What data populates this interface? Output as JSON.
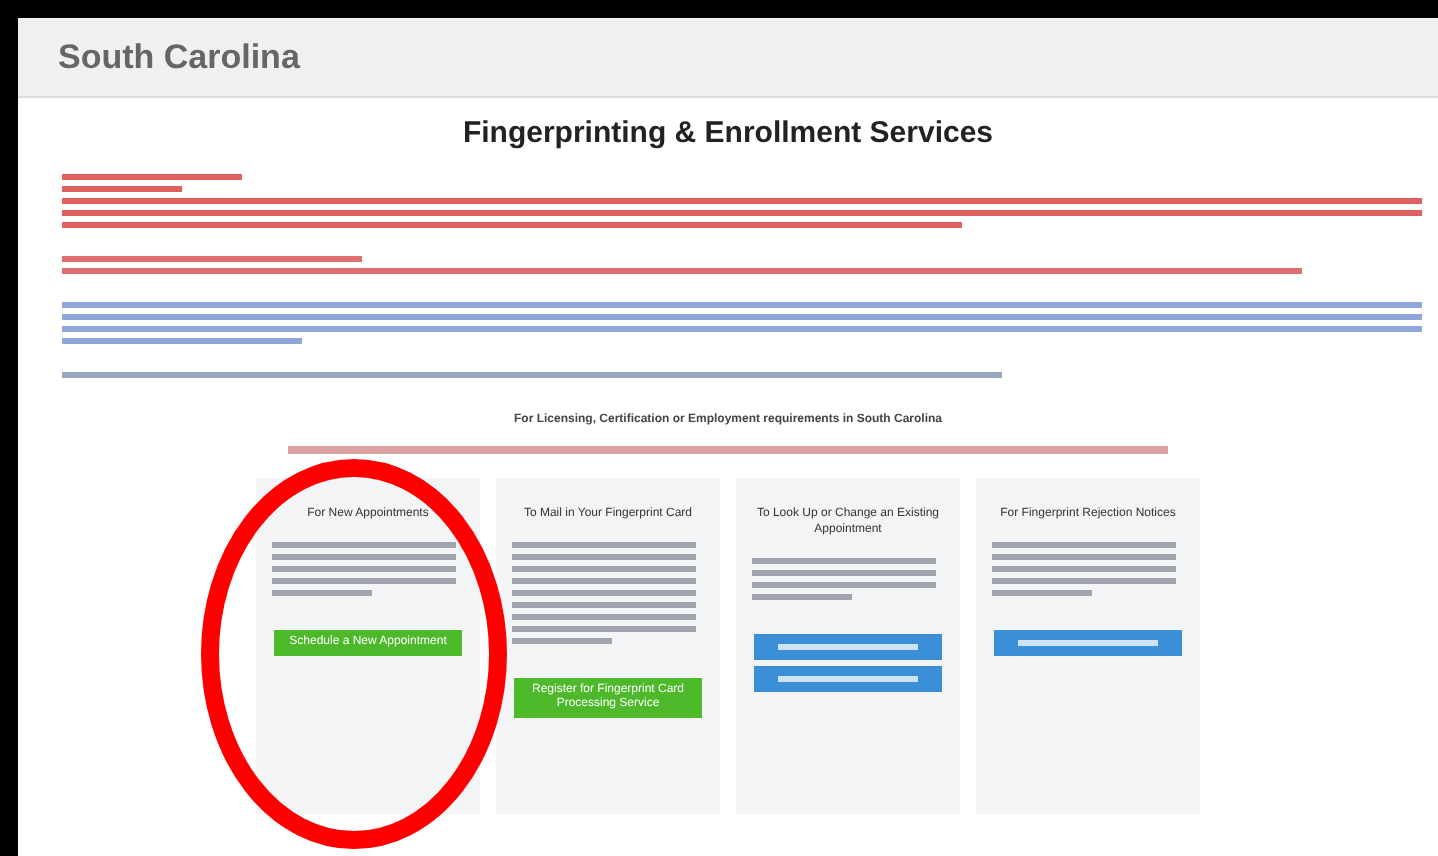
{
  "header": {
    "title": "South Carolina"
  },
  "page_title": "Fingerprinting & Enrollment Services",
  "section_heading": "For Licensing, Certification or Employment requirements in South Carolina",
  "cards": [
    {
      "title": "For New Appointments",
      "buttons": [
        {
          "label": "Schedule a New Appointment",
          "color": "#4cb82a"
        }
      ]
    },
    {
      "title": "To Mail in Your Fingerprint Card",
      "buttons": [
        {
          "label": "Register for Fingerprint Card Processing Service",
          "color": "#4cb82a"
        }
      ]
    },
    {
      "title": "To Look Up or Change an Existing Appointment",
      "buttons": [
        {
          "color": "#3a8fd6"
        },
        {
          "color": "#3a8fd6"
        }
      ]
    },
    {
      "title": "For Fingerprint Rejection Notices",
      "buttons": [
        {
          "color": "#3a8fd6"
        }
      ]
    }
  ]
}
